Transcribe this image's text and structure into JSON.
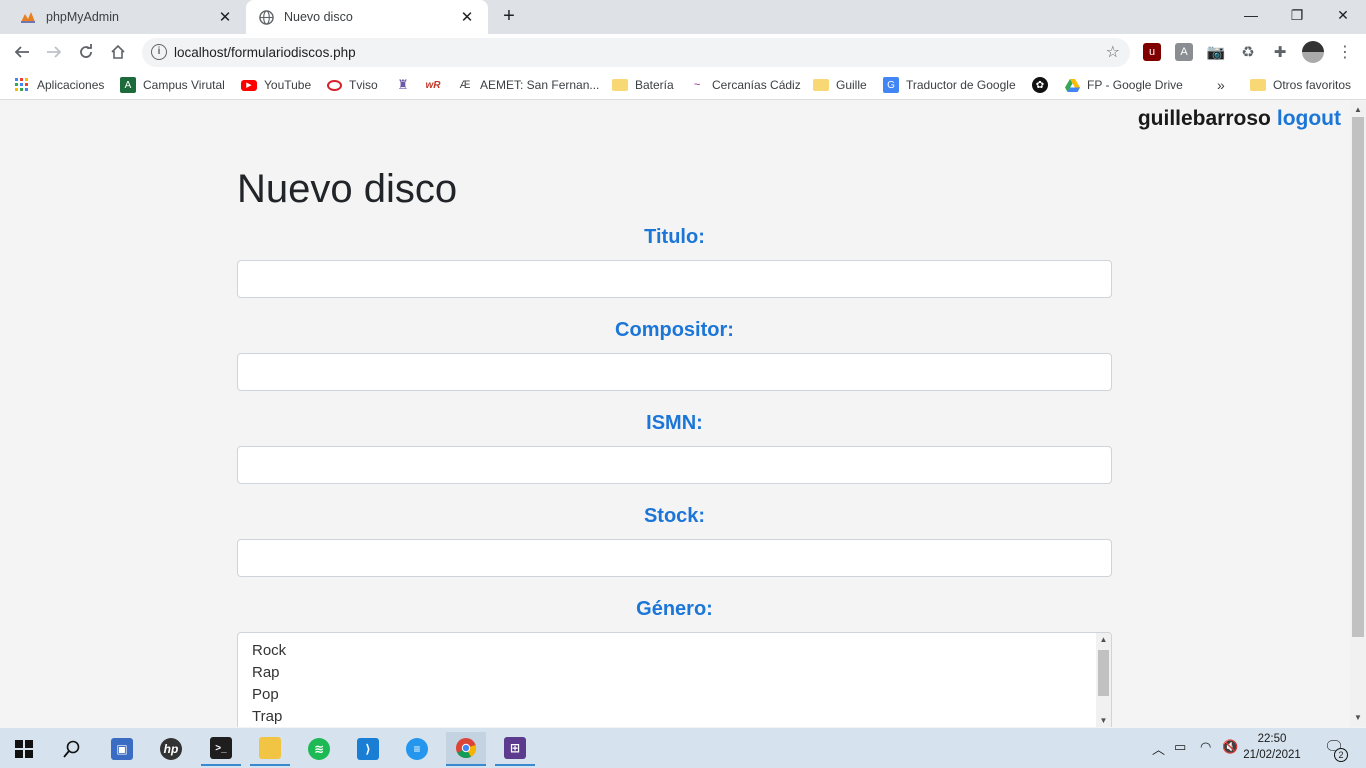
{
  "browser": {
    "tabs": [
      {
        "title": "phpMyAdmin",
        "icon": "phpmyadmin-icon",
        "active": false
      },
      {
        "title": "Nuevo disco",
        "icon": "globe-icon",
        "active": true
      }
    ],
    "url": "localhost/formulariodiscos.php",
    "bookmarks": [
      {
        "label": "Aplicaciones",
        "icon": "apps-grid-icon"
      },
      {
        "label": "Campus Virutal",
        "icon": "campus-icon"
      },
      {
        "label": "YouTube",
        "icon": "youtube-icon"
      },
      {
        "label": "Tviso",
        "icon": "tviso-icon"
      },
      {
        "label": "",
        "icon": "crest-icon"
      },
      {
        "label": "",
        "icon": "wordreference-icon"
      },
      {
        "label": "AEMET: San Fernan...",
        "icon": "aemet-icon"
      },
      {
        "label": "Batería",
        "icon": "folder-icon"
      },
      {
        "label": "Cercanías Cádiz",
        "icon": "renfe-icon"
      },
      {
        "label": "Guille",
        "icon": "folder-icon"
      },
      {
        "label": "Traductor de Google",
        "icon": "translate-icon"
      },
      {
        "label": "",
        "icon": "openai-icon"
      },
      {
        "label": "FP - Google Drive",
        "icon": "drive-icon"
      },
      {
        "label": "Otros favoritos",
        "icon": "folder-icon"
      }
    ]
  },
  "page": {
    "username": "guillebarroso",
    "logout": "logout",
    "title": "Nuevo disco",
    "fields": [
      {
        "label": "Titulo:",
        "value": ""
      },
      {
        "label": "Compositor:",
        "value": ""
      },
      {
        "label": "ISMN:",
        "value": ""
      },
      {
        "label": "Stock:",
        "value": ""
      }
    ],
    "genre_label": "Género:",
    "genres": [
      "Rock",
      "Rap",
      "Pop",
      "Trap"
    ]
  },
  "taskbar": {
    "time": "22:50",
    "date": "21/02/2021",
    "notifications": "2"
  },
  "colors": {
    "accent": "#1b76d8",
    "page_bg": "#f4f4f4",
    "taskbar_bg": "#d6e3ee"
  }
}
